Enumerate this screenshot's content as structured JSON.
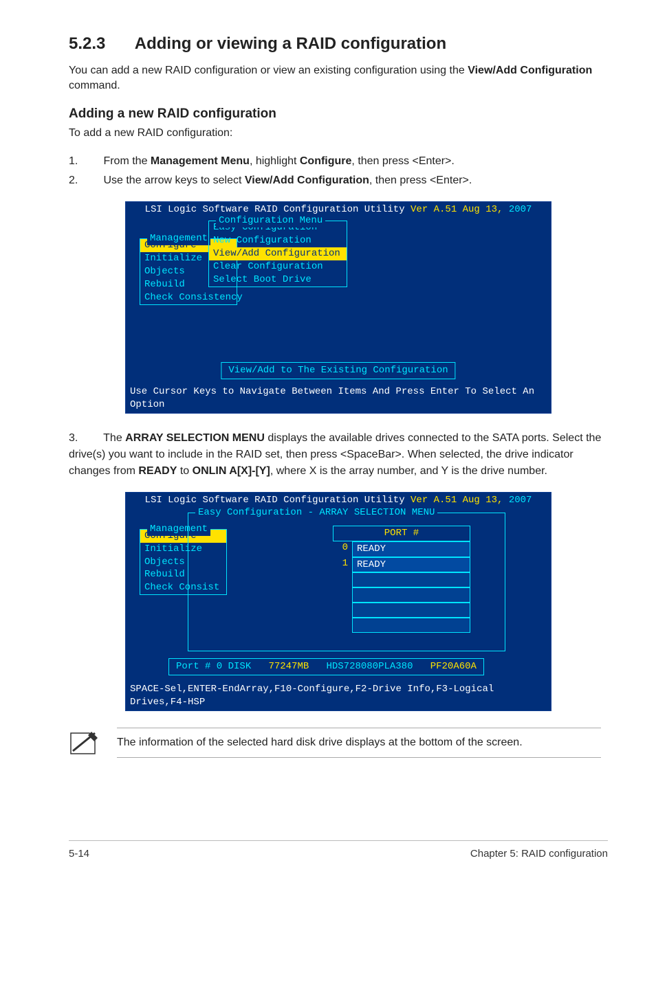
{
  "section": {
    "number": "5.2.3",
    "title": "Adding or viewing a RAID configuration"
  },
  "intro": {
    "p1_pre": "You can add a new RAID configuration or view an existing configuration using the ",
    "p1_bold": "View/Add Configuration",
    "p1_post": " command."
  },
  "subheading1": "Adding a new RAID configuration",
  "subintro": "To add a new RAID configuration:",
  "steps_a": [
    {
      "n": "1.",
      "pre": "From the ",
      "b1": "Management Menu",
      "mid": ", highlight ",
      "b2": "Configure",
      "post": ", then press <Enter>."
    },
    {
      "n": "2.",
      "pre": "Use the arrow keys to select ",
      "b1": "View/Add Configuration",
      "mid": "",
      "b2": "",
      "post": ", then press <Enter>."
    }
  ],
  "term_header": {
    "prefix": "LSI Logic Software RAID Configuration Utility ",
    "ver_label": "Ver A.51 Aug 13, ",
    "year": "2007"
  },
  "term1": {
    "mgmt_label": "Management",
    "mgmt_items": [
      "Configure",
      "Initialize",
      "Objects",
      "Rebuild",
      "Check Consistency"
    ],
    "conf_label": "Configuration Menu",
    "conf_items": [
      "Easy Configuration",
      "New Configuration",
      "View/Add Configuration",
      "Clear Configuration",
      "Select Boot Drive"
    ],
    "conf_selected_index": 2,
    "msg": "View/Add to The Existing Configuration",
    "footer": "Use Cursor Keys to Navigate Between Items And Press Enter To Select An Option"
  },
  "step3": {
    "n": "3.",
    "pre": "The ",
    "b1": "ARRAY SELECTION MENU",
    "seg1": " displays the available drives connected to the SATA ports. Select the drive(s) you want to include in the RAID set, then press <SpaceBar>. When selected, the drive indicator changes from ",
    "b2": "READY",
    "seg2": " to ",
    "b3": "ONLIN A[X]-[Y]",
    "seg3": ", where X is the array number, and Y is the drive number."
  },
  "term2": {
    "arr_label": "Easy Configuration - ARRAY SELECTION MENU",
    "mgmt_label": "Management",
    "mgmt_items": [
      "Configure",
      "Initialize",
      "Objects",
      "Rebuild",
      "Check Consist"
    ],
    "port_header": "PORT #",
    "port_rows": [
      {
        "idx": "0",
        "status": "READY"
      },
      {
        "idx": "1",
        "status": "READY"
      },
      {
        "idx": "",
        "status": ""
      },
      {
        "idx": "",
        "status": ""
      },
      {
        "idx": "",
        "status": ""
      },
      {
        "idx": "",
        "status": ""
      }
    ],
    "info": {
      "left": "Port # 0 DISK",
      "size": "77247MB",
      "model": "HDS728080PLA380",
      "fw": "PF20A60A"
    },
    "footer": "SPACE-Sel,ENTER-EndArray,F10-Configure,F2-Drive Info,F3-Logical Drives,F4-HSP"
  },
  "note": "The information of the selected hard disk drive displays at the bottom of the screen.",
  "footer": {
    "left": "5-14",
    "right": "Chapter 5: RAID configuration"
  }
}
